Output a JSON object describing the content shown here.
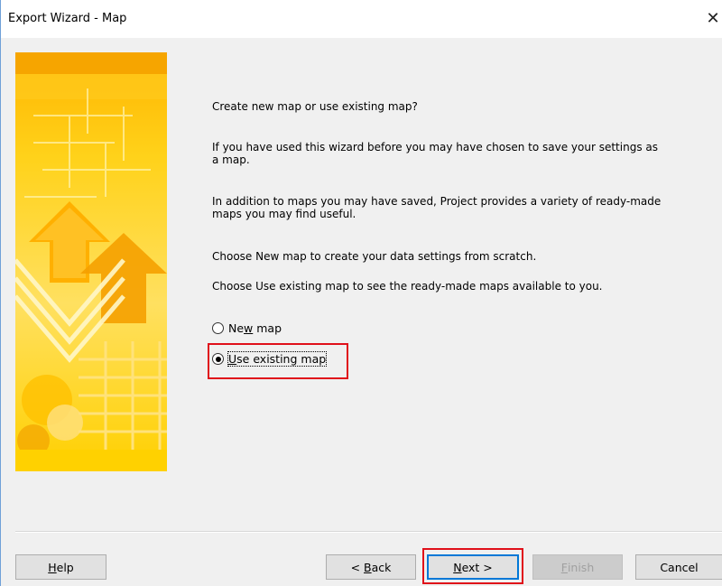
{
  "window": {
    "title": "Export Wizard - Map",
    "close_glyph": "✕"
  },
  "banner": {
    "icon": "decorative-wizard-banner",
    "colors": [
      "#ffd200",
      "#ffc000",
      "#ffe680",
      "#f5a800"
    ]
  },
  "content": {
    "question": "Create new map or use existing map?",
    "para1_line1": "If you have used this wizard before you may have chosen to save your settings as",
    "para1_line2": "a map.",
    "para2_line1": "In addition to maps you may have saved, Project provides a variety of ready-made",
    "para2_line2": "maps you may find useful.",
    "para3": "Choose New map to create your data settings from scratch.",
    "para4": "Choose Use existing map to see the ready-made maps available to you."
  },
  "options": {
    "new_map": {
      "prefix": "Ne",
      "accel": "w",
      "suffix": " map",
      "selected": false
    },
    "use_existing": {
      "prefix": "",
      "accel": "U",
      "suffix": "se existing map",
      "selected": true
    }
  },
  "buttons": {
    "help": {
      "accel": "H",
      "rest": "elp"
    },
    "back": {
      "pre": "< ",
      "accel": "B",
      "rest": "ack"
    },
    "next": {
      "accel": "N",
      "rest": "ext >"
    },
    "finish": {
      "accel": "F",
      "rest": "inish",
      "disabled": true
    },
    "cancel": {
      "label": "Cancel"
    }
  },
  "colors": {
    "highlight": "#e0101a",
    "default_button_border": "#0078d7",
    "window_border": "#6fa0d8"
  }
}
